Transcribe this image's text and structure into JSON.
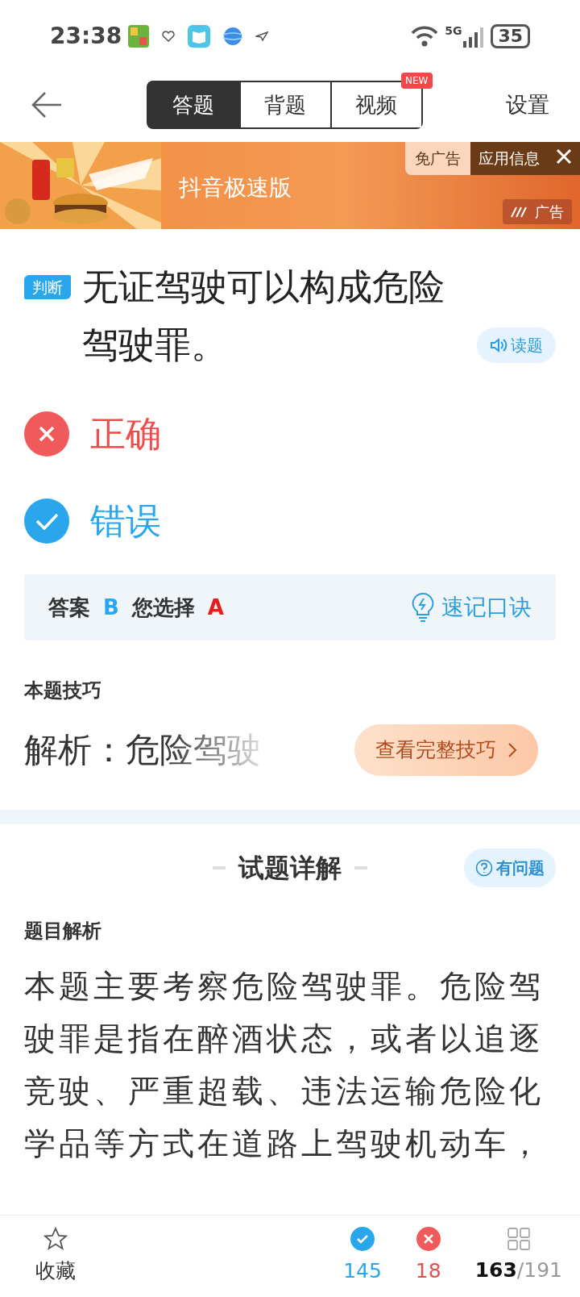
{
  "status_bar": {
    "time": "23:38",
    "network": "5G",
    "battery": "35"
  },
  "header": {
    "tabs": [
      {
        "label": "答题",
        "selected": true
      },
      {
        "label": "背题",
        "selected": false
      },
      {
        "label": "视频",
        "selected": false,
        "badge": "NEW"
      }
    ],
    "settings": "设置"
  },
  "ad": {
    "title": "抖音极速版",
    "remove_ads": "免广告",
    "app_info": "应用信息",
    "ad_label": "广告"
  },
  "question": {
    "type_tag": "判断",
    "text": "无证驾驶可以构成危险驾驶罪。",
    "read_button": "读题"
  },
  "options": [
    {
      "label": "正确",
      "kind": "wrong"
    },
    {
      "label": "错误",
      "kind": "right"
    }
  ],
  "answer": {
    "label": "答案",
    "correct": "B",
    "your_label": "您选择",
    "yours": "A",
    "mnemonic": "速记口诀"
  },
  "tips": {
    "heading": "本题技巧",
    "preview": "解析：危险驾驶",
    "button": "查看完整技巧"
  },
  "details": {
    "title": "试题详解",
    "report": "有问题",
    "subheading": "题目解析",
    "paragraph": "本题主要考察危险驾驶罪。危险驾驶罪是指在醉酒状态，或者以追逐竞驶、严重超载、违法运输危险化学品等方式在道路上驾驶机动车，"
  },
  "bottom_bar": {
    "favorite": "收藏",
    "correct_count": "145",
    "wrong_count": "18",
    "current": "163",
    "total": "/191"
  }
}
